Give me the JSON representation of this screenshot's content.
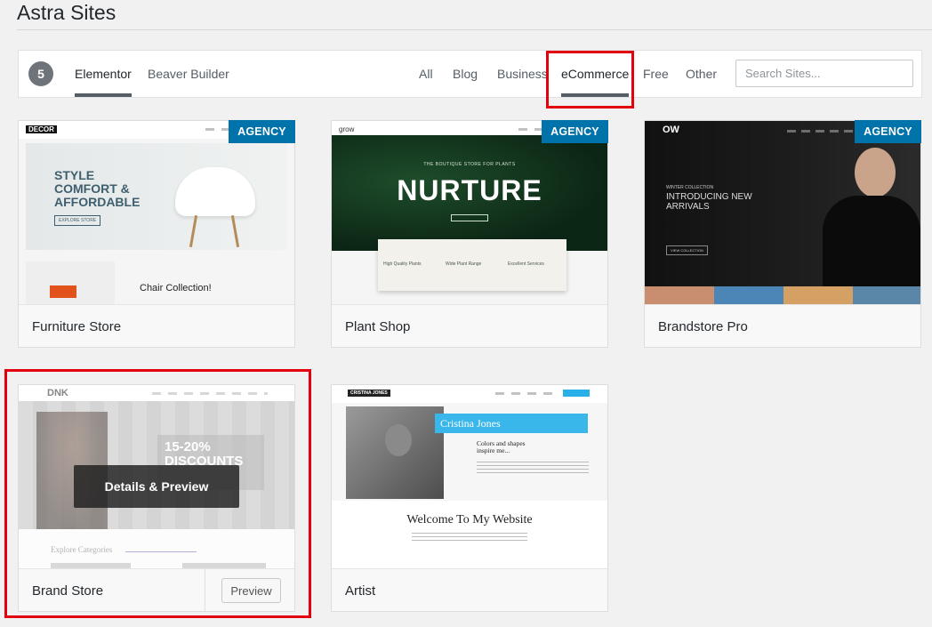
{
  "header": {
    "title": "Astra Sites"
  },
  "filters": {
    "count": "5",
    "page_builders": [
      {
        "label": "Elementor",
        "active": true
      },
      {
        "label": "Beaver Builder",
        "active": false
      }
    ],
    "categories": [
      {
        "label": "All",
        "active": false
      },
      {
        "label": "Blog",
        "active": false
      },
      {
        "label": "Business",
        "active": false
      },
      {
        "label": "eCommerce",
        "active": true
      },
      {
        "label": "Free",
        "active": false
      },
      {
        "label": "Other",
        "active": false
      }
    ],
    "search_placeholder": "Search Sites..."
  },
  "sites": [
    {
      "name": "Furniture Store",
      "badge": "AGENCY",
      "thumb": {
        "logo": "DECOR",
        "headline": "STYLE COMFORT & AFFORDABLE",
        "cta": "EXPLORE STORE",
        "sub": "Chair Collection!"
      }
    },
    {
      "name": "Plant Shop",
      "badge": "AGENCY",
      "thumb": {
        "logo": "grow",
        "headline": "NURTURE",
        "kicker": "THE BOUTIQUE STORE FOR PLANTS",
        "f1": "High Quality Plants",
        "f2": "Wide Plant Range",
        "f3": "Excellent Services"
      }
    },
    {
      "name": "Brandstore Pro",
      "badge": "AGENCY",
      "thumb": {
        "logo": "OW",
        "kicker": "WINTER COLLECTION",
        "headline": "INTRODUCING NEW ARRIVALS",
        "cta": "VIEW COLLECTION"
      }
    },
    {
      "name": "Brand Store",
      "preview_label": "Preview",
      "overlay": "Details & Preview",
      "thumb": {
        "logo": "DNK",
        "headline": "15-20% DISCOUNTS",
        "sub": "Explore Categories"
      }
    },
    {
      "name": "Artist",
      "thumb": {
        "logo": "CRISTINA JONES",
        "name": "Cristina Jones",
        "tag": "Colors and shapes inspire me...",
        "welcome": "Welcome To My Website"
      }
    }
  ],
  "colors": {
    "badge": "#0073aa",
    "highlight": "#e3000f"
  }
}
